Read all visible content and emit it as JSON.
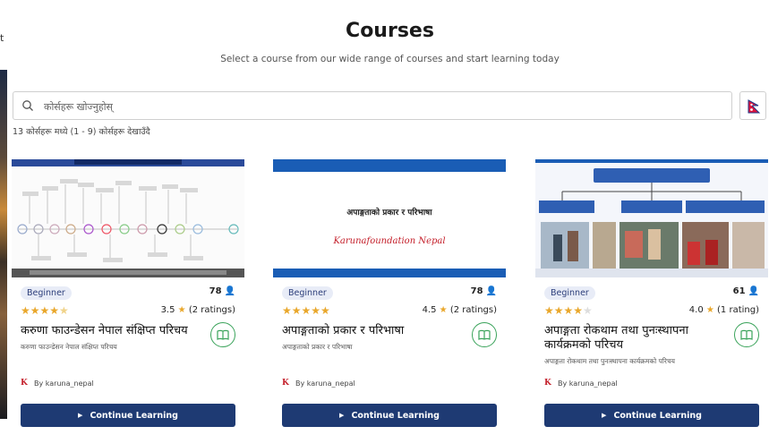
{
  "page": {
    "title": "Courses",
    "subtitle": "Select a course from our wide range of courses and start learning today"
  },
  "search": {
    "placeholder": "कोर्सहरू खोज्नुहोस्"
  },
  "result_count": "13 कोर्सहरू मध्ये (1 - 9) कोर्सहरू देखाउँदै",
  "colors": {
    "primary": "#1e3a73",
    "accent_green": "#3aa35a",
    "star": "#e9a72b",
    "brand_red": "#c4202b",
    "badge_bg": "#e8ecf7"
  },
  "courses": [
    {
      "level": "Beginner",
      "students": "78",
      "stars": 3.5,
      "rating": "3.5",
      "ratings_count": "(2 ratings)",
      "title": "करुणा फाउन्डेसन नेपाल संक्षिप्त परिचय",
      "description": "करुणा फाउन्डेसन नेपाल संक्षिप्त परिचय",
      "author": "By karuna_nepal",
      "cta": "Continue Learning"
    },
    {
      "level": "Beginner",
      "students": "78",
      "stars": 4.5,
      "rating": "4.5",
      "ratings_count": "(2 ratings)",
      "title": "अपाङ्गताको प्रकार र परिभाषा",
      "description": "अपाङ्गताको प्रकार र परिभाषा",
      "banner_heading": "अपाङ्गताको प्रकार र परिभाषा",
      "banner_logo": "Karunafoundation Nepal",
      "author": "By karuna_nepal",
      "cta": "Continue Learning"
    },
    {
      "level": "Beginner",
      "students": "61",
      "stars": 4.0,
      "rating": "4.0",
      "ratings_count": "(1 rating)",
      "title": "अपाङ्गता रोकथाम तथा पुनःस्थापना कार्यक्रमको परिचय",
      "description": "अपाङ्गता रोकथाम तथा पुनःस्थापना कार्यक्रमको परिचय",
      "author": "By karuna_nepal",
      "cta": "Continue Learning"
    }
  ]
}
